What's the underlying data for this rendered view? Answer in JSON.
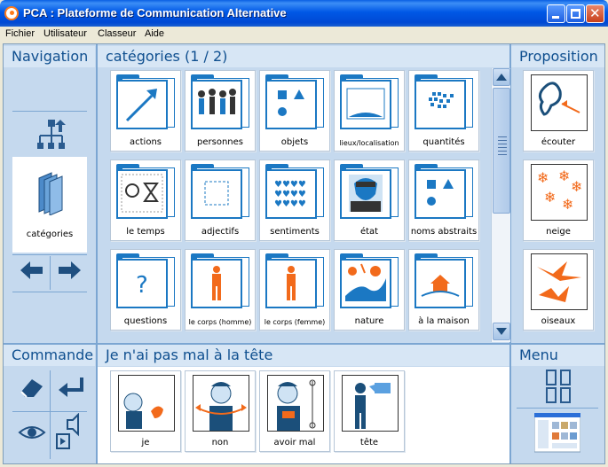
{
  "window": {
    "title": "PCA : Plateforme de Communication Alternative"
  },
  "menu": [
    "Fichier",
    "Utilisateur",
    "Classeur",
    "Aide"
  ],
  "navigation": {
    "title": "Navigation",
    "current_label": "catégories"
  },
  "categories": {
    "title": "catégories (1 / 2)",
    "items": [
      {
        "label": "actions",
        "icon": "arrow-icon"
      },
      {
        "label": "personnes",
        "icon": "people-icon"
      },
      {
        "label": "objets",
        "icon": "shapes-icon"
      },
      {
        "label": "lieux/localisation",
        "icon": "place-icon"
      },
      {
        "label": "quantités",
        "icon": "quantity-icon"
      },
      {
        "label": "le temps",
        "icon": "time-icon"
      },
      {
        "label": "adjectifs",
        "icon": "dotted-square-icon"
      },
      {
        "label": "sentiments",
        "icon": "hearts-icon"
      },
      {
        "label": "état",
        "icon": "face-icon"
      },
      {
        "label": "noms abstraits",
        "icon": "abstract-shapes-icon"
      },
      {
        "label": "questions",
        "icon": "question-icon"
      },
      {
        "label": "le corps (homme)",
        "icon": "man-body-icon"
      },
      {
        "label": "le corps (femme)",
        "icon": "woman-body-icon"
      },
      {
        "label": "nature",
        "icon": "nature-icon"
      },
      {
        "label": "à la maison",
        "icon": "house-icon"
      }
    ]
  },
  "proposition": {
    "title": "Proposition",
    "items": [
      {
        "label": "écouter",
        "icon": "ear-icon"
      },
      {
        "label": "neige",
        "icon": "snow-icon"
      },
      {
        "label": "oiseaux",
        "icon": "birds-icon"
      }
    ]
  },
  "commande": {
    "title": "Commande"
  },
  "sentence": {
    "title": "Je n'ai pas mal à la tête",
    "words": [
      {
        "label": "je",
        "icon": "je-icon"
      },
      {
        "label": "non",
        "icon": "non-icon"
      },
      {
        "label": "avoir mal",
        "icon": "pain-icon"
      },
      {
        "label": "tête",
        "icon": "head-icon"
      }
    ]
  },
  "menu_panel": {
    "title": "Menu"
  },
  "colors": {
    "accent": "#1b78c3",
    "header_text": "#0f4f8f",
    "panel_bg": "#c5d9ee",
    "orange": "#f26a1b"
  }
}
